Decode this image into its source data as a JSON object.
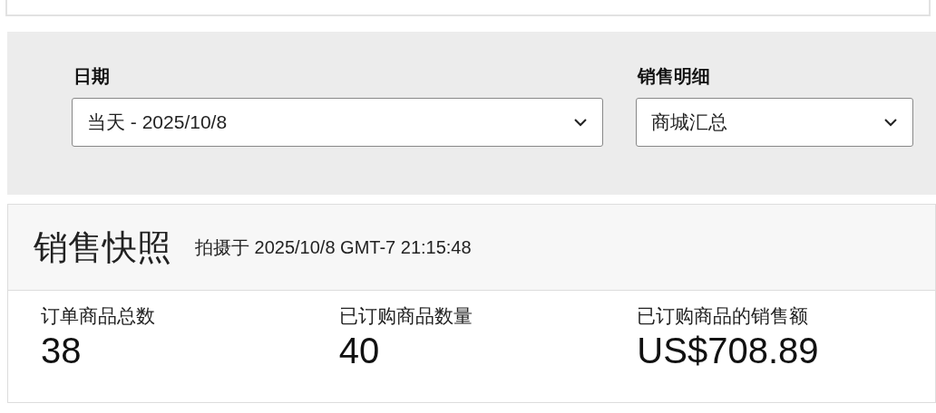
{
  "filters": [
    {
      "label": "日期",
      "value": "当天 - 2025/10/8"
    },
    {
      "label": "销售明细",
      "value": "商城汇总"
    }
  ],
  "snapshot": {
    "title": "销售快照",
    "timestamp": "拍摄于 2025/10/8 GMT-7 21:15:48",
    "metrics": [
      {
        "label": "订单商品总数",
        "value": "38"
      },
      {
        "label": "已订购商品数量",
        "value": "40"
      },
      {
        "label": "已订购商品的销售额",
        "value": "US$708.89"
      }
    ]
  }
}
